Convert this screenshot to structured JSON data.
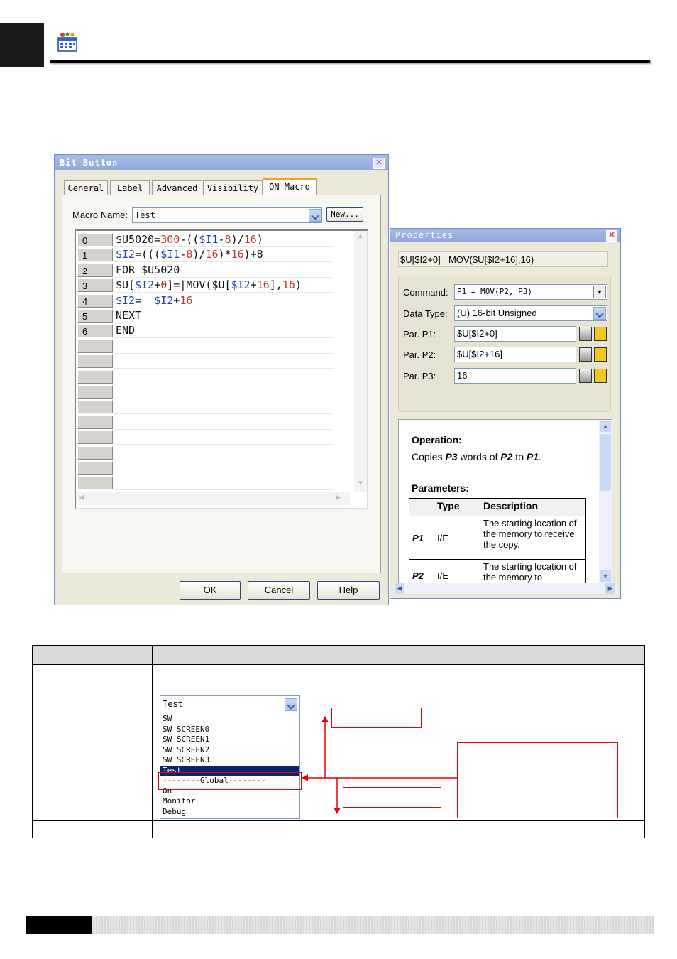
{
  "dialog": {
    "title": "Bit Button",
    "tabs": [
      "General",
      "Label",
      "Advanced",
      "Visibility",
      "ON Macro"
    ],
    "macro_name_label": "Macro Name:",
    "macro_name_value": "Test",
    "new_button": "New...",
    "code_lines": [
      {
        "num": "0",
        "segments": [
          [
            "$U5020=",
            "k"
          ],
          [
            "300",
            "r"
          ],
          [
            "-((",
            "k"
          ],
          [
            "$I1",
            "b"
          ],
          [
            "-",
            "k"
          ],
          [
            "8",
            "r"
          ],
          [
            ")/",
            "k"
          ],
          [
            "16",
            "r"
          ],
          [
            ")",
            "k"
          ]
        ]
      },
      {
        "num": "1",
        "segments": [
          [
            "$I2",
            "b"
          ],
          [
            "=(((",
            "k"
          ],
          [
            "$I1",
            "b"
          ],
          [
            "-",
            "k"
          ],
          [
            "8",
            "r"
          ],
          [
            ")/",
            "k"
          ],
          [
            "16",
            "r"
          ],
          [
            ")*",
            "k"
          ],
          [
            "16",
            "r"
          ],
          [
            ")+8",
            "k"
          ]
        ]
      },
      {
        "num": "2",
        "segments": [
          [
            "FOR $U5020",
            "k"
          ]
        ]
      },
      {
        "num": "3",
        "segments": [
          [
            "$U[",
            "k"
          ],
          [
            "$I2",
            "b"
          ],
          [
            "+",
            "k"
          ],
          [
            "0",
            "r"
          ],
          [
            "]=",
            "k"
          ],
          [
            "|",
            "k"
          ],
          [
            "MOV($U[",
            "k"
          ],
          [
            "$I2",
            "b"
          ],
          [
            "+",
            "k"
          ],
          [
            "16",
            "r"
          ],
          [
            "],",
            "k"
          ],
          [
            "16",
            "r"
          ],
          [
            ")",
            "k"
          ]
        ]
      },
      {
        "num": "4",
        "segments": [
          [
            "$I2",
            "b"
          ],
          [
            "=  ",
            "k"
          ],
          [
            "$I2",
            "b"
          ],
          [
            "+",
            "k"
          ],
          [
            "16",
            "r"
          ]
        ]
      },
      {
        "num": "5",
        "segments": [
          [
            "NEXT",
            "k"
          ]
        ]
      },
      {
        "num": "6",
        "segments": [
          [
            "END",
            "k"
          ]
        ]
      }
    ],
    "ok_button": "OK",
    "cancel_button": "Cancel",
    "help_button": "Help"
  },
  "properties": {
    "title": "Properties",
    "expression": "$U[$I2+0]= MOV($U[$I2+16],16)",
    "command_label": "Command:",
    "command_value": "P1 = MOV(P2, P3)",
    "data_type_label": "Data Type:",
    "data_type_value": "(U) 16-bit Unsigned",
    "p1_label": "Par. P1:",
    "p1_value": "$U[$I2+0]",
    "p2_label": "Par. P2:",
    "p2_value": "$U[$I2+16]",
    "p3_label": "Par. P3:",
    "p3_value": "16",
    "operation_heading": "Operation:",
    "operation_parts": [
      "Copies ",
      "P3",
      " words of ",
      "P2",
      " to ",
      "P1",
      "."
    ],
    "parameters_heading": "Parameters:",
    "table_headers": [
      "",
      "Type",
      "Description"
    ],
    "table_rows": [
      [
        "P1",
        "I/E",
        "The starting location of the memory to receive the copy."
      ],
      [
        "P2",
        "I/E",
        "The starting location of the memory to"
      ]
    ]
  },
  "macro_list": {
    "selected": "Test",
    "items": [
      "SW",
      "SW SCREEN0",
      "SW SCREEN1",
      "SW SCREEN2",
      "SW SCREEN3",
      "Test",
      "--------Global--------",
      "On",
      "Monitor",
      "Debug"
    ],
    "highlighted_index": 5
  },
  "colors": {
    "keyword": "#111111",
    "number": "#c0392b",
    "variable": "#1f3fbf",
    "highlight": "#0a246a",
    "annotation": "#e00000"
  }
}
